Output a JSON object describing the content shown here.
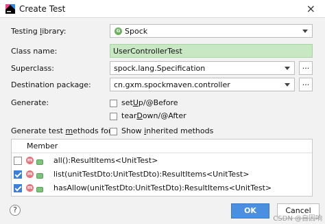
{
  "window": {
    "title": "Create Test",
    "close_glyph": "×"
  },
  "form": {
    "testing_library": {
      "label_pre": "Testing ",
      "label_key": "l",
      "label_post": "ibrary:",
      "value": "Spock",
      "icon": "G"
    },
    "class_name": {
      "label": "Class name:",
      "value": "UserControllerTest"
    },
    "superclass": {
      "label": "Superclass:",
      "value": "spock.lang.Specification",
      "browse": "..."
    },
    "destination": {
      "label": "Destination package:",
      "value": "cn.gxm.spockmaven.controller",
      "browse": "..."
    },
    "generate": {
      "label": "Generate:",
      "setup": {
        "pre": "set",
        "key": "U",
        "post": "p/@Before",
        "checked": false
      },
      "teardown": {
        "pre": "tear",
        "key": "D",
        "post": "own/@After",
        "checked": false
      }
    },
    "methods": {
      "label_pre": "Generate test ",
      "label_key": "m",
      "label_post": "ethods for:",
      "show_inherited": {
        "pre": "Show ",
        "key": "i",
        "post": "nherited methods",
        "checked": false
      }
    }
  },
  "table": {
    "header": "Member",
    "rows": [
      {
        "text": "all():ResultItems<UnitTest>",
        "checked": false,
        "icon": "m"
      },
      {
        "text": "list(unitTestDto:UnitTestDto):ResultItems<UnitTest>",
        "checked": true,
        "icon": "m"
      },
      {
        "text": "hasAllow(unitTestDto:UnitTestDto):ResultItems<UnitTest>",
        "checked": true,
        "icon": "m"
      }
    ]
  },
  "footer": {
    "help": "?",
    "ok": "OK",
    "cancel": "Cancel"
  },
  "watermark": "CSDN @自因响",
  "colors": {
    "accent": "#4a8fe0",
    "classname_bg": "#c8e8c4",
    "checkbox_on": "#3d7fd6"
  }
}
